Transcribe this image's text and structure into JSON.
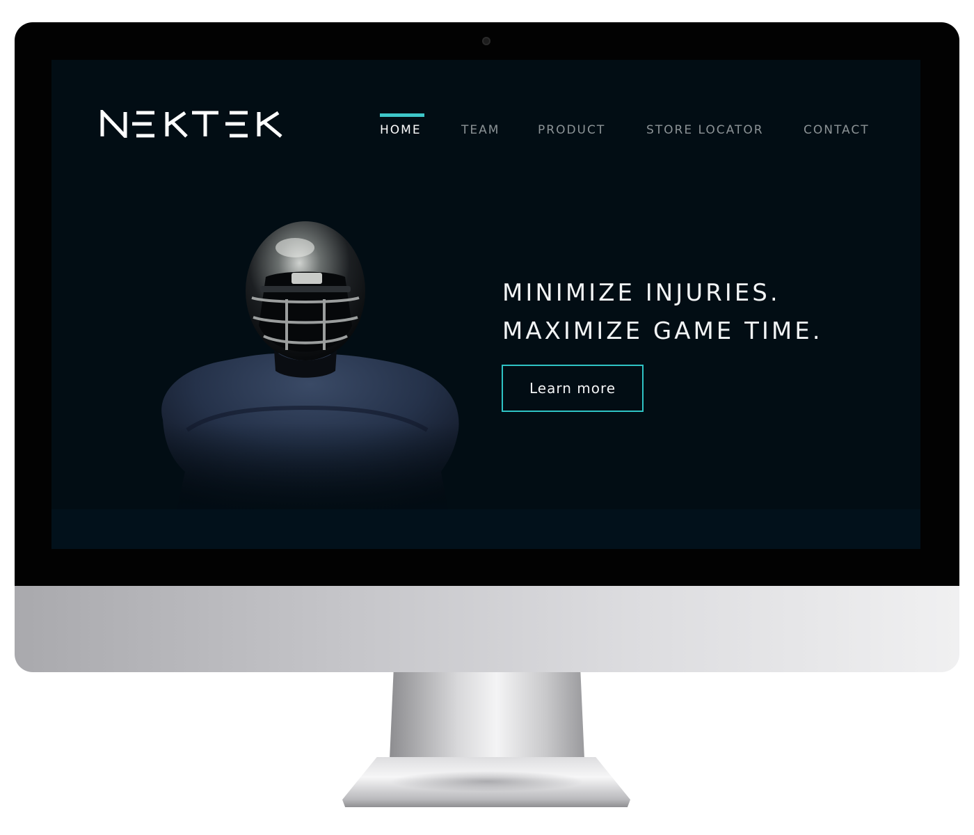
{
  "site": {
    "brand": "NEKTEK",
    "accent_color": "#3ec7c9",
    "background_color": "#020d14"
  },
  "nav": {
    "items": [
      {
        "label": "HOME",
        "active": true
      },
      {
        "label": "TEAM",
        "active": false
      },
      {
        "label": "PRODUCT",
        "active": false
      },
      {
        "label": "STORE LOCATOR",
        "active": false
      },
      {
        "label": "CONTACT",
        "active": false
      }
    ]
  },
  "hero": {
    "headline_line1": "MINIMIZE INJURIES.",
    "headline_line2": "MAXIMIZE GAME TIME.",
    "cta_label": "Learn more",
    "image": "football-player-image"
  },
  "device": {
    "type": "desktop-monitor"
  }
}
